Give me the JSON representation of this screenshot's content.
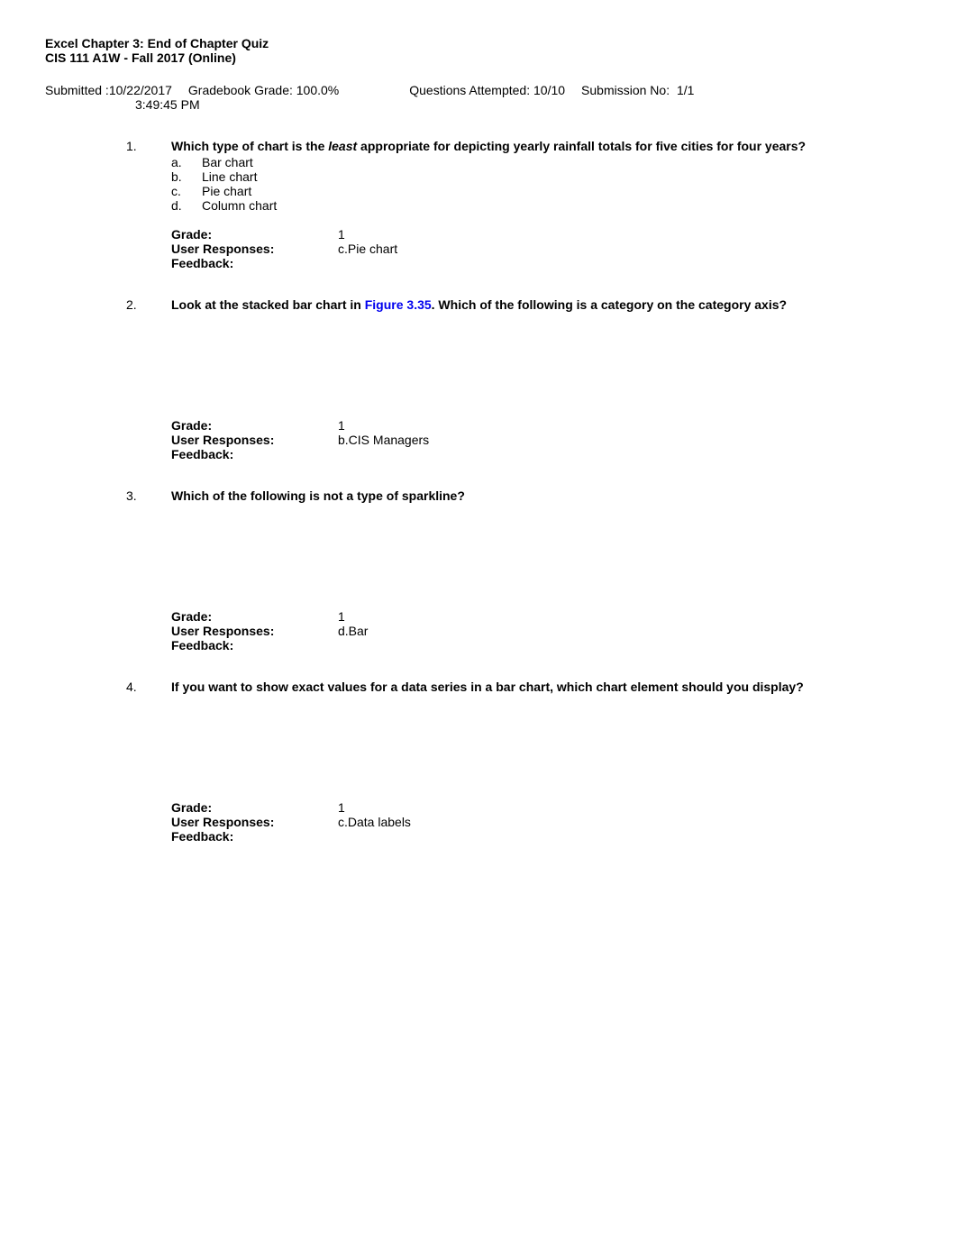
{
  "header": {
    "quiz_title": "Excel Chapter 3: End of Chapter Quiz",
    "course": "CIS 111 A1W - Fall 2017 (Online)"
  },
  "submission": {
    "submitted_label": "Submitted :",
    "submitted_date": "10/22/2017",
    "submitted_time": "3:49:45 PM",
    "gradebook_label": "Gradebook Grade:",
    "gradebook_value": "100.0%",
    "questions_label": "Questions Attempted:",
    "questions_value": "10/10",
    "submission_no_label": "Submission No:",
    "submission_no_value": "1/1"
  },
  "questions": [
    {
      "number": "1.",
      "text_pre": "Which type of chart is the ",
      "text_italic": "least",
      "text_post": " appropriate for depicting yearly rainfall totals for five cities for four years?",
      "options": [
        {
          "letter": "a.",
          "text": "Bar chart"
        },
        {
          "letter": "b.",
          "text": "Line chart"
        },
        {
          "letter": "c.",
          "text": "Pie chart"
        },
        {
          "letter": "d.",
          "text": "Column chart"
        }
      ],
      "grade_label": "Grade:",
      "grade_value": "1",
      "user_responses_label": "User Responses:",
      "user_responses_value": "c.Pie chart",
      "feedback_label": "Feedback:"
    },
    {
      "number": "2.",
      "text_pre": "Look at the stacked bar chart in ",
      "text_figure": "Figure 3.35",
      "text_post": ". Which of the following is a category on the category axis?",
      "grade_label": "Grade:",
      "grade_value": "1",
      "user_responses_label": "User Responses:",
      "user_responses_value": "b.CIS Managers",
      "feedback_label": "Feedback:"
    },
    {
      "number": "3.",
      "text_full": "Which of the following is not a type of sparkline?",
      "grade_label": "Grade:",
      "grade_value": "1",
      "user_responses_label": "User Responses:",
      "user_responses_value": "d.Bar",
      "feedback_label": "Feedback:"
    },
    {
      "number": "4.",
      "text_full": "If you want to show exact values for a data series in a bar chart, which chart element should you display?",
      "grade_label": "Grade:",
      "grade_value": "1",
      "user_responses_label": "User Responses:",
      "user_responses_value": "c.Data labels",
      "feedback_label": "Feedback:"
    }
  ]
}
